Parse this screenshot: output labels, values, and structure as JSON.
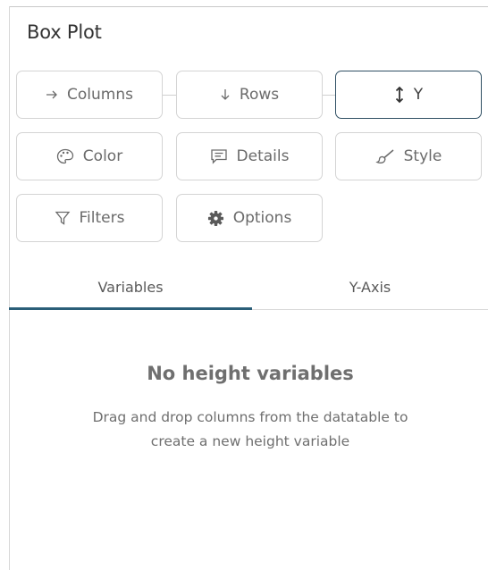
{
  "panel": {
    "title": "Box Plot"
  },
  "buttons": {
    "columns": {
      "label": "Columns",
      "icon": "arrow-right-icon"
    },
    "rows": {
      "label": "Rows",
      "icon": "arrow-down-icon"
    },
    "y": {
      "label": "Y",
      "icon": "vertical-arrows-icon",
      "selected": true
    },
    "color": {
      "label": "Color",
      "icon": "palette-icon"
    },
    "details": {
      "label": "Details",
      "icon": "comment-icon"
    },
    "style": {
      "label": "Style",
      "icon": "brush-icon"
    },
    "filters": {
      "label": "Filters",
      "icon": "filter-icon"
    },
    "options": {
      "label": "Options",
      "icon": "gear-icon"
    }
  },
  "tabs": [
    {
      "label": "Variables",
      "active": true
    },
    {
      "label": "Y-Axis",
      "active": false
    }
  ],
  "empty_state": {
    "title": "No height variables",
    "line1": "Drag and drop columns from the datatable to",
    "line2": "create a new height variable"
  },
  "colors": {
    "accent": "#2a5e78",
    "selected_border": "#2f4f63",
    "border": "#d4d4d4",
    "text_muted": "#6f6f6f"
  }
}
